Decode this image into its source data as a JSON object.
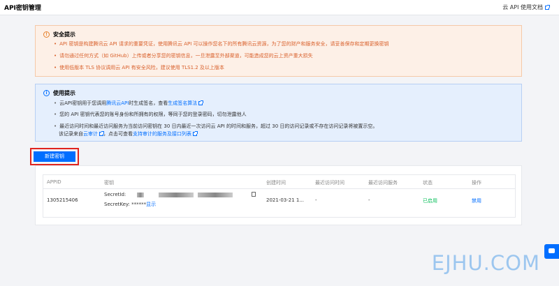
{
  "header": {
    "title": "API密钥管理",
    "doc_link": "云 API 使用文档"
  },
  "warning": {
    "icon": "warning-circle-icon",
    "title": "安全提示",
    "items": [
      "API 密钥是构建腾讯云 API 请求的重要凭证，使用腾讯云 API 可以操作您名下的所有腾讯云资源，为了您的财产和服务安全，请妥善保存和定期更换密钥",
      "请勿通过任何方式（如 GitHub）上传或者分享您的密钥信息，一旦泄露至外部渠道，可能造成您的云上资产重大损失",
      "使用低版本 TLS 协议调用云 API 有安全风险，建议使用 TLS1.2 及以上版本"
    ]
  },
  "info": {
    "icon": "info-circle-icon",
    "title": "使用提示",
    "item1_pre": "云API密钥用于您调用",
    "item1_link1": "腾讯云API",
    "item1_mid": "时生成签名，查看",
    "item1_link2": "生成签名算法",
    "item2": "您的 API 密钥代表您的账号身份和所拥有的权限，等同于您的登录密码，切勿泄露他人",
    "item3": "最近访问时间和最近访问服务为当前访问密钥在 30 日内最近一次访问云 API 的时间和服务，超过 30 日的访问记录或不存在访问记录将被置示空。",
    "item4_pre": "该记录来自",
    "item4_link1": "云审计",
    "item4_mid": "，点击可查看",
    "item4_link2": "支持审计的服务及接口列表"
  },
  "create_button": "新建密钥",
  "table": {
    "headers": [
      "APPID",
      "密钥",
      "创建时间",
      "最近访问时间",
      "最近访问服务",
      "状态",
      "操作"
    ],
    "row": {
      "appid": "1305215406",
      "secret_id_label": "SecretId:",
      "secret_key_label": "SecretKey:",
      "secret_key_mask": "******",
      "show_link": "显示",
      "created": "2021-03-21 1...",
      "last_access": "-",
      "last_service": "-",
      "status": "已启用",
      "action": "禁用"
    }
  },
  "watermark": "EJHU.COM",
  "colors": {
    "primary": "#006eff",
    "warning": "#d9602b",
    "success": "#0abf5b",
    "highlight": "#e0241e"
  }
}
